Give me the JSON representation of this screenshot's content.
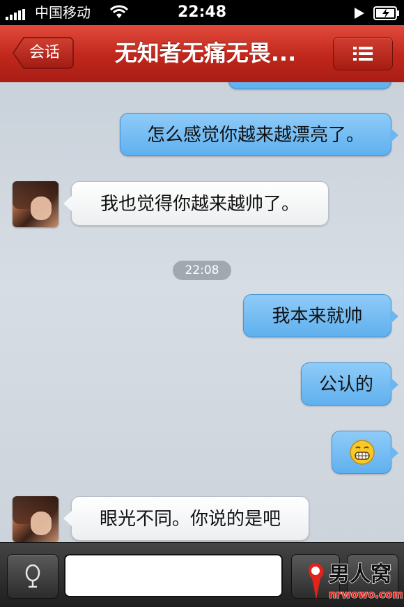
{
  "status_bar": {
    "carrier": "中国移动",
    "time": "22:48"
  },
  "nav": {
    "back_label": "会话",
    "title": "无知者无痛无畏..."
  },
  "chat": {
    "messages": [
      {
        "side": "out",
        "text": "怎么感觉你越来越漂亮了。"
      },
      {
        "side": "in",
        "text": "我也觉得你越来越帅了。"
      },
      {
        "side": "out",
        "text": "我本来就帅"
      },
      {
        "side": "out",
        "text": "公认的"
      },
      {
        "side": "out",
        "emoji": "grin-emoji"
      },
      {
        "side": "in",
        "text": "眼光不同。你说的是吧"
      }
    ],
    "timestamp": "22:08"
  },
  "input_bar": {
    "message_value": ""
  },
  "watermark": {
    "logo_text": "男人窝",
    "site": "nrwowo.com"
  },
  "colors": {
    "nav_red": "#c0271c",
    "outgoing_bubble": "#6db7f1",
    "incoming_bubble": "#ffffff"
  }
}
